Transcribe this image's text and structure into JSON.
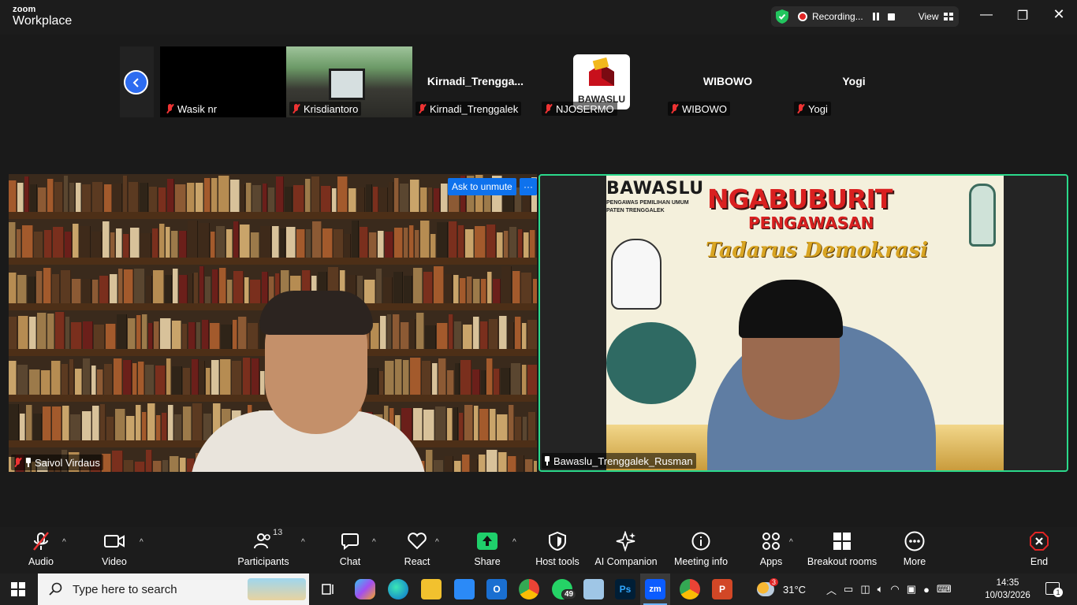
{
  "app": {
    "brand_top": "zoom",
    "brand_bottom": "Workplace"
  },
  "recording": {
    "label": "Recording...",
    "view_label": "View"
  },
  "thumbnails": [
    {
      "display_name": "",
      "tag": "Wasik nr"
    },
    {
      "display_name": "",
      "tag": "Krisdiantoro"
    },
    {
      "display_name": "Kirnadi_Trengga...",
      "tag": "Kirnadi_Trenggalek"
    },
    {
      "display_name": "BAWASLU",
      "tag": "NJOSERMO"
    },
    {
      "display_name": "WIBOWO",
      "tag": "WIBOWO"
    },
    {
      "display_name": "Yogi",
      "tag": "Yogi"
    }
  ],
  "main_left": {
    "name": "Saivol Virdaus",
    "ask_to_unmute": "Ask to unmute",
    "more": "···"
  },
  "main_right": {
    "name": "Bawaslu_Trenggalek_Rusman",
    "slide": {
      "org": "BAWASLU",
      "org_sub_1": "PENGAWAS PEMILIHAN UMUM",
      "org_sub_2": "PATEN TRENGGALEK",
      "title": "NGABUBURIT",
      "subtitle": "PENGAWASAN",
      "tagline": "Tadarus Demokrasi"
    }
  },
  "toolbar": {
    "audio": "Audio",
    "video": "Video",
    "participants": "Participants",
    "participants_count": "13",
    "chat": "Chat",
    "react": "React",
    "share": "Share",
    "host_tools": "Host tools",
    "ai_companion": "AI Companion",
    "meeting_info": "Meeting info",
    "apps": "Apps",
    "breakout_rooms": "Breakout rooms",
    "more": "More",
    "end": "End"
  },
  "taskbar": {
    "search_placeholder": "Type here to search",
    "whatsapp_badge": "49",
    "weather_badge": "3",
    "temperature": "31°C",
    "time": "14:35",
    "date": "10/03/2026",
    "notification_count": "1"
  },
  "colors": {
    "accent": "#0e72ed",
    "active_speaker": "#2bd98b",
    "end": "#e02424",
    "share": "#1fcf6b"
  }
}
